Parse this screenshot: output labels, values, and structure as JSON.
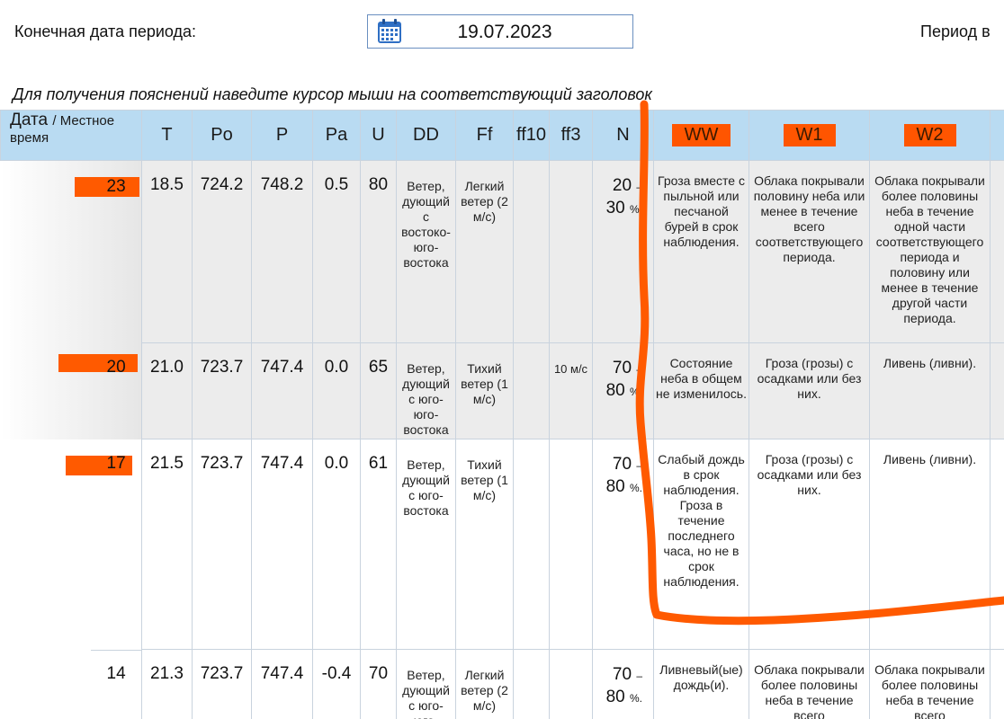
{
  "header": {
    "end_date_label": "Конечная дата периода:",
    "end_date_value": "19.07.2023",
    "period_label": "Период в",
    "hint": "Для получения пояснений наведите курсор мыши на соответствующий заголовок"
  },
  "columns": {
    "date": "Дата",
    "local_time": "/ Местное время",
    "T": "T",
    "Po": "Po",
    "P": "P",
    "Pa": "Pa",
    "U": "U",
    "DD": "DD",
    "Ff": "Ff",
    "ff10": "ff10",
    "ff3": "ff3",
    "N": "N",
    "WW": "WW",
    "W1": "W1",
    "W2": "W2"
  },
  "rows": [
    {
      "hour": "23",
      "T": "18.5",
      "Po": "724.2",
      "P": "748.2",
      "Pa": "0.5",
      "U": "80",
      "DD": "Ветер, дующий с востоко-юго-востока",
      "Ff": "Легкий ветер (2 м/с)",
      "ff10": "",
      "ff3": "",
      "N1": "20",
      "N2": "30",
      "WW": "Гроза вместе с пыльной или песчаной бурей в срок наблюдения.",
      "W1": "Облака покрывали половину неба или менее в течение всего соответствующего периода.",
      "W2": "Облака покрывали более половины неба в течение одной части соответствующего периода и половину или менее в течение другой части периода."
    },
    {
      "hour": "20",
      "T": "21.0",
      "Po": "723.7",
      "P": "747.4",
      "Pa": "0.0",
      "U": "65",
      "DD": "Ветер, дующий с юго-юго-востока",
      "Ff": "Тихий ветер (1 м/с)",
      "ff10": "",
      "ff3": "10 м/с",
      "N1": "70",
      "N2": "80",
      "WW": "Состояние неба в общем не изменилось.",
      "W1": "Гроза (грозы) с осадками или без них.",
      "W2": "Ливень (ливни)."
    },
    {
      "hour": "17",
      "T": "21.5",
      "Po": "723.7",
      "P": "747.4",
      "Pa": "0.0",
      "U": "61",
      "DD": "Ветер, дующий с юго-востока",
      "Ff": "Тихий ветер (1 м/с)",
      "ff10": "",
      "ff3": "",
      "N1": "70",
      "N2": "80",
      "WW": "Слабый дождь в срок наблюдения. Гроза в течение последнего часа, но не в срок наблюдения.",
      "W1": "Гроза (грозы) с осадками или без них.",
      "W2": "Ливень (ливни)."
    },
    {
      "hour": "14",
      "T": "21.3",
      "Po": "723.7",
      "P": "747.4",
      "Pa": "-0.4",
      "U": "70",
      "DD": "Ветер, дующий с юго-юго-",
      "Ff": "Легкий ветер (2 м/с)",
      "ff10": "",
      "ff3": "",
      "N1": "70",
      "N2": "80",
      "WW": "Ливневый(ые) дождь(и).",
      "W1": "Облака покрывали более половины неба в течение всего",
      "W2": "Облака покрывали более половины неба в течение всего"
    }
  ],
  "units": {
    "dash": "–",
    "percent": "%."
  },
  "colors": {
    "header_bg": "#b9dbf2",
    "annotation": "#ff5500",
    "row_shade": "#ececec"
  },
  "icons": {
    "date_picker": "calendar-icon"
  }
}
